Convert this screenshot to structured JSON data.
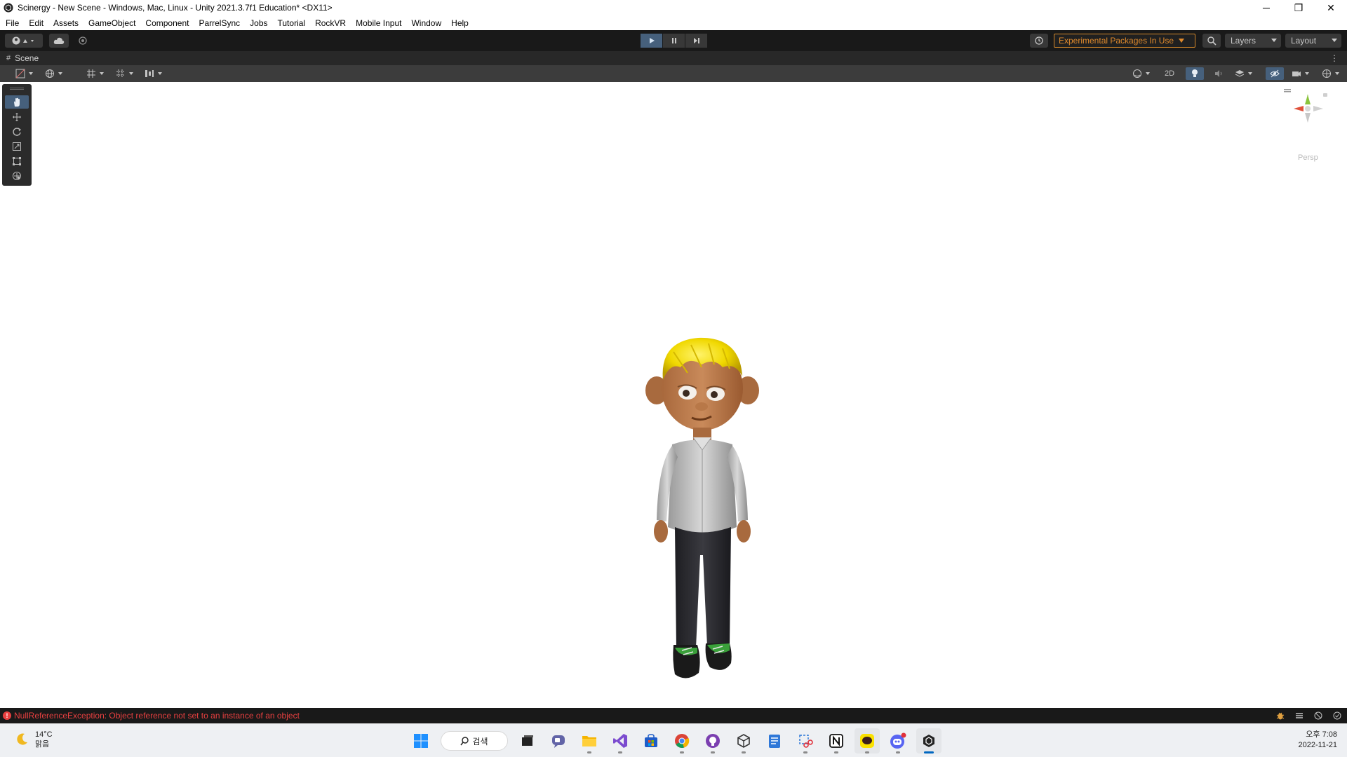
{
  "window": {
    "title": "Scinergy - New Scene - Windows, Mac, Linux - Unity 2021.3.7f1 Education* <DX11>",
    "minimize": "─",
    "maximize": "❐",
    "close": "✕"
  },
  "menu": [
    "File",
    "Edit",
    "Assets",
    "GameObject",
    "Component",
    "ParrelSync",
    "Jobs",
    "Tutorial",
    "RockVR",
    "Mobile Input",
    "Window",
    "Help"
  ],
  "toolbar": {
    "experimental_label": "Experimental Packages In Use",
    "layers_label": "Layers",
    "layout_label": "Layout"
  },
  "scene": {
    "tab_label": "Scene",
    "mode_2d": "2D",
    "persp_label": "Persp"
  },
  "status": {
    "error_message": "NullReferenceException: Object reference not set to an instance of an object"
  },
  "taskbar": {
    "temperature": "14°C",
    "weather_condition": "맑음",
    "search_label": "검색",
    "time": "오후 7:08",
    "date": "2022-11-21"
  },
  "colors": {
    "accent": "#46607c",
    "warning": "#e08a2c",
    "error": "#e84040"
  }
}
